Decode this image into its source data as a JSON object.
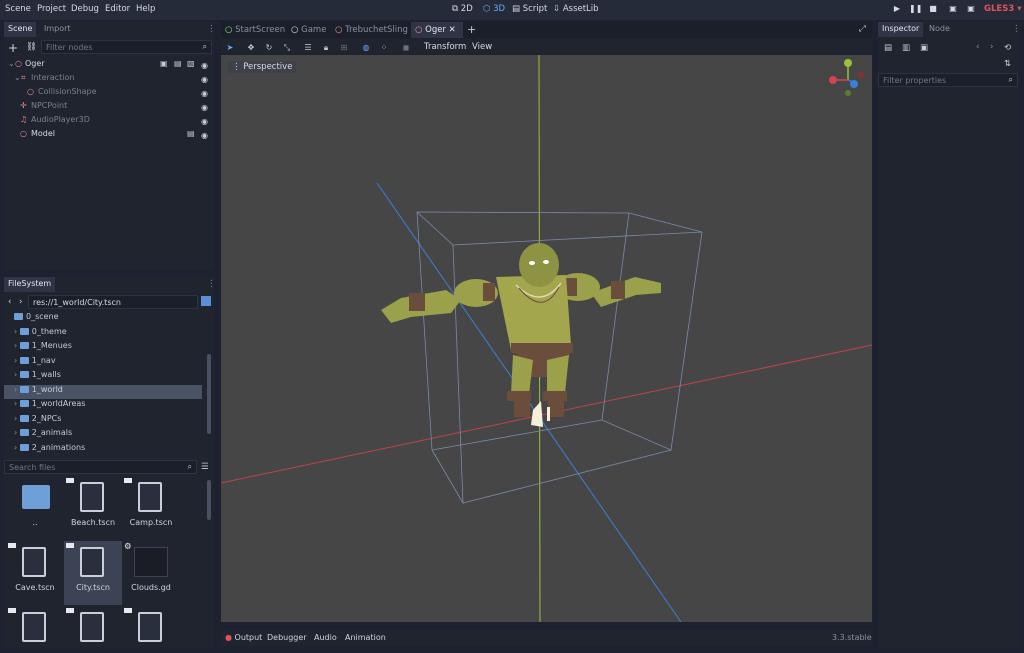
{
  "menu": [
    "Scene",
    "Project",
    "Debug",
    "Editor",
    "Help"
  ],
  "modes": {
    "m2d": "2D",
    "m3d": "3D",
    "script": "Script",
    "assetlib": "AssetLib"
  },
  "renderer": "GLES3",
  "scene_tabs": {
    "scene": "Scene",
    "import": "Import"
  },
  "filter_nodes_placeholder": "Filter nodes",
  "scene_tree": [
    {
      "label": "Oger"
    },
    {
      "label": "Interaction"
    },
    {
      "label": "CollisionShape"
    },
    {
      "label": "NPCPoint"
    },
    {
      "label": "AudioPlayer3D"
    },
    {
      "label": "Model"
    }
  ],
  "editor_tabs": [
    "StartScreen",
    "Game",
    "TrebuchetSling",
    "Oger"
  ],
  "toolbar": {
    "transform": "Transform",
    "view": "View"
  },
  "viewport": {
    "perspective_label": "Perspective"
  },
  "filesystem": {
    "title": "FileSystem",
    "path": "res://1_world/City.tscn",
    "folders": [
      "0_scene",
      "0_theme",
      "1_Menues",
      "1_nav",
      "1_walls",
      "1_world",
      "1_worldAreas",
      "2_NPCs",
      "2_animals",
      "2_animations"
    ],
    "selected": "1_world",
    "search_placeholder": "Search files",
    "files": [
      "..",
      "Beach.tscn",
      "Camp.tscn",
      "Cave.tscn",
      "City.tscn",
      "Clouds.gd"
    ]
  },
  "inspector": {
    "tab_inspector": "Inspector",
    "tab_node": "Node",
    "filter_placeholder": "Filter properties"
  },
  "bottom": {
    "output": "Output",
    "debugger": "Debugger",
    "audio": "Audio",
    "animation": "Animation",
    "version": "3.3.stable"
  },
  "colors": {
    "accent": "#6fa6ff",
    "gles": "#e0535c",
    "x_axis": "#d0434f",
    "y_axis": "#9ac03d",
    "z_axis": "#3a80d8"
  }
}
